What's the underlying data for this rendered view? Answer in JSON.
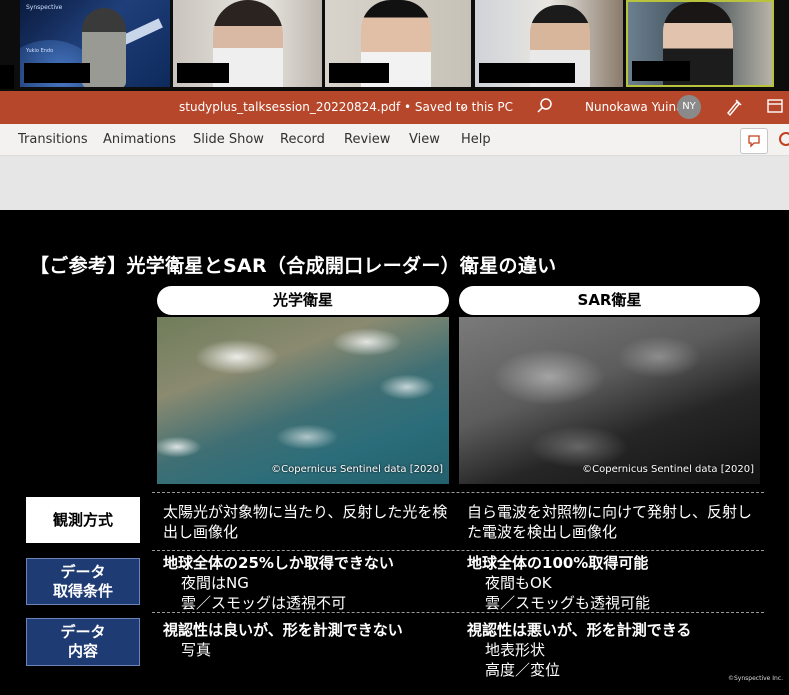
{
  "window": {
    "filename": "studyplus_talksession_20220824.pdf • Saved to this PC",
    "user_name": "Nunokawa Yuina",
    "user_initials": "NY",
    "accent": "#b7472a"
  },
  "ribbon": {
    "tabs": [
      "Transitions",
      "Animations",
      "Slide Show",
      "Record",
      "Review",
      "View",
      "Help"
    ]
  },
  "video_tiles": {
    "tile1_logo": "Synspective",
    "tile1_name": "Yukio Endo"
  },
  "slide": {
    "title": "【ご参考】光学衛星とSAR（合成開口レーダー）衛星の違い",
    "col_left": "光学衛星",
    "col_right": "SAR衛星",
    "image_credit": "©Copernicus Sentinel data [2020]",
    "rows": [
      {
        "label": "観測方式",
        "left": "太陽光が対象物に当たり、反射した光を検出し画像化",
        "right": "自ら電波を対照物に向けて発射し、反射した電波を検出し画像化"
      },
      {
        "label_line1": "データ",
        "label_line2": "取得条件",
        "left_head": "地球全体の25%しか取得できない",
        "left_items": [
          "夜間はNG",
          "雲／スモッグは透視不可"
        ],
        "right_head": "地球全体の100%取得可能",
        "right_items": [
          "夜間もOK",
          "雲／スモッグも透視可能"
        ]
      },
      {
        "label_line1": "データ",
        "label_line2": "内容",
        "left_head": "視認性は良いが、形を計測できない",
        "left_items": [
          "写真"
        ],
        "right_head": "視認性は悪いが、形を計測できる",
        "right_items": [
          "地表形状",
          "高度／変位"
        ]
      }
    ],
    "footer_credit": "©Synspective Inc."
  }
}
